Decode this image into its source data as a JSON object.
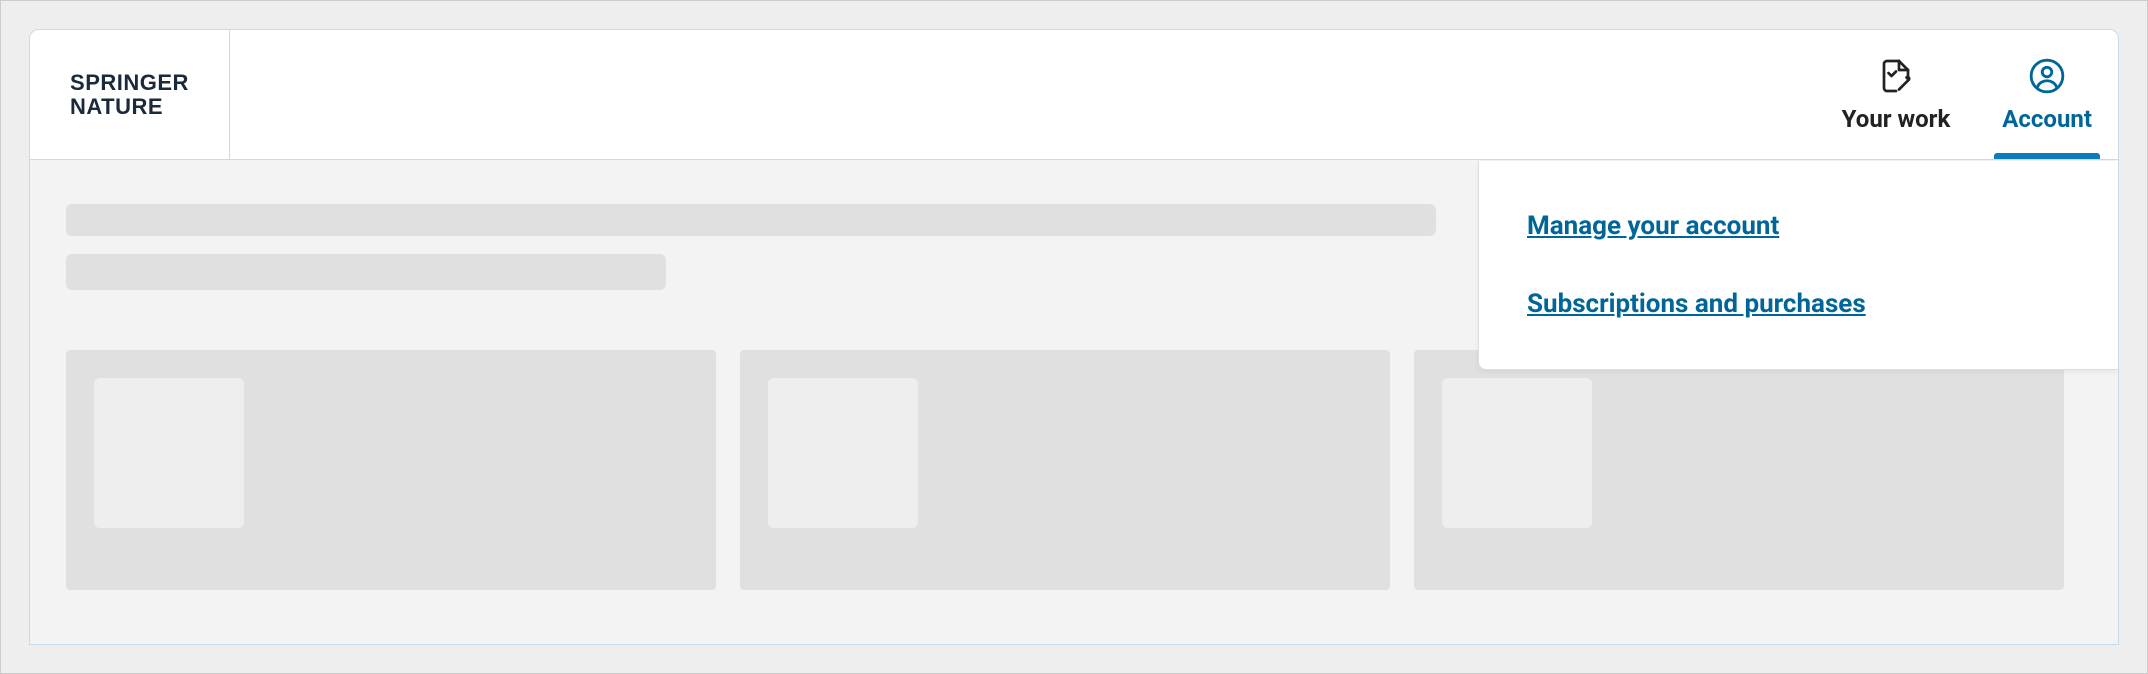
{
  "brand": {
    "line1": "Springer",
    "line2": "Nature"
  },
  "header": {
    "nav": [
      {
        "id": "your-work",
        "label": "Your work",
        "active": false
      },
      {
        "id": "account",
        "label": "Account",
        "active": true
      }
    ]
  },
  "account_menu": {
    "items": [
      {
        "label": "Manage your account"
      },
      {
        "label": "Subscriptions and purchases"
      }
    ]
  }
}
